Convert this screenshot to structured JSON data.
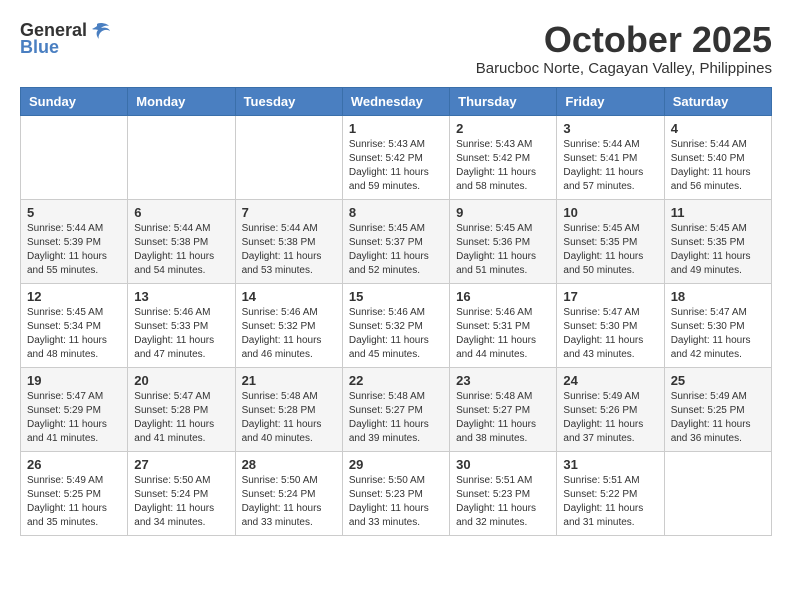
{
  "logo": {
    "general": "General",
    "blue": "Blue"
  },
  "title": "October 2025",
  "subtitle": "Barucboc Norte, Cagayan Valley, Philippines",
  "days_of_week": [
    "Sunday",
    "Monday",
    "Tuesday",
    "Wednesday",
    "Thursday",
    "Friday",
    "Saturday"
  ],
  "weeks": [
    [
      {
        "day": "",
        "info": ""
      },
      {
        "day": "",
        "info": ""
      },
      {
        "day": "",
        "info": ""
      },
      {
        "day": "1",
        "info": "Sunrise: 5:43 AM\nSunset: 5:42 PM\nDaylight: 11 hours and 59 minutes."
      },
      {
        "day": "2",
        "info": "Sunrise: 5:43 AM\nSunset: 5:42 PM\nDaylight: 11 hours and 58 minutes."
      },
      {
        "day": "3",
        "info": "Sunrise: 5:44 AM\nSunset: 5:41 PM\nDaylight: 11 hours and 57 minutes."
      },
      {
        "day": "4",
        "info": "Sunrise: 5:44 AM\nSunset: 5:40 PM\nDaylight: 11 hours and 56 minutes."
      }
    ],
    [
      {
        "day": "5",
        "info": "Sunrise: 5:44 AM\nSunset: 5:39 PM\nDaylight: 11 hours and 55 minutes."
      },
      {
        "day": "6",
        "info": "Sunrise: 5:44 AM\nSunset: 5:38 PM\nDaylight: 11 hours and 54 minutes."
      },
      {
        "day": "7",
        "info": "Sunrise: 5:44 AM\nSunset: 5:38 PM\nDaylight: 11 hours and 53 minutes."
      },
      {
        "day": "8",
        "info": "Sunrise: 5:45 AM\nSunset: 5:37 PM\nDaylight: 11 hours and 52 minutes."
      },
      {
        "day": "9",
        "info": "Sunrise: 5:45 AM\nSunset: 5:36 PM\nDaylight: 11 hours and 51 minutes."
      },
      {
        "day": "10",
        "info": "Sunrise: 5:45 AM\nSunset: 5:35 PM\nDaylight: 11 hours and 50 minutes."
      },
      {
        "day": "11",
        "info": "Sunrise: 5:45 AM\nSunset: 5:35 PM\nDaylight: 11 hours and 49 minutes."
      }
    ],
    [
      {
        "day": "12",
        "info": "Sunrise: 5:45 AM\nSunset: 5:34 PM\nDaylight: 11 hours and 48 minutes."
      },
      {
        "day": "13",
        "info": "Sunrise: 5:46 AM\nSunset: 5:33 PM\nDaylight: 11 hours and 47 minutes."
      },
      {
        "day": "14",
        "info": "Sunrise: 5:46 AM\nSunset: 5:32 PM\nDaylight: 11 hours and 46 minutes."
      },
      {
        "day": "15",
        "info": "Sunrise: 5:46 AM\nSunset: 5:32 PM\nDaylight: 11 hours and 45 minutes."
      },
      {
        "day": "16",
        "info": "Sunrise: 5:46 AM\nSunset: 5:31 PM\nDaylight: 11 hours and 44 minutes."
      },
      {
        "day": "17",
        "info": "Sunrise: 5:47 AM\nSunset: 5:30 PM\nDaylight: 11 hours and 43 minutes."
      },
      {
        "day": "18",
        "info": "Sunrise: 5:47 AM\nSunset: 5:30 PM\nDaylight: 11 hours and 42 minutes."
      }
    ],
    [
      {
        "day": "19",
        "info": "Sunrise: 5:47 AM\nSunset: 5:29 PM\nDaylight: 11 hours and 41 minutes."
      },
      {
        "day": "20",
        "info": "Sunrise: 5:47 AM\nSunset: 5:28 PM\nDaylight: 11 hours and 41 minutes."
      },
      {
        "day": "21",
        "info": "Sunrise: 5:48 AM\nSunset: 5:28 PM\nDaylight: 11 hours and 40 minutes."
      },
      {
        "day": "22",
        "info": "Sunrise: 5:48 AM\nSunset: 5:27 PM\nDaylight: 11 hours and 39 minutes."
      },
      {
        "day": "23",
        "info": "Sunrise: 5:48 AM\nSunset: 5:27 PM\nDaylight: 11 hours and 38 minutes."
      },
      {
        "day": "24",
        "info": "Sunrise: 5:49 AM\nSunset: 5:26 PM\nDaylight: 11 hours and 37 minutes."
      },
      {
        "day": "25",
        "info": "Sunrise: 5:49 AM\nSunset: 5:25 PM\nDaylight: 11 hours and 36 minutes."
      }
    ],
    [
      {
        "day": "26",
        "info": "Sunrise: 5:49 AM\nSunset: 5:25 PM\nDaylight: 11 hours and 35 minutes."
      },
      {
        "day": "27",
        "info": "Sunrise: 5:50 AM\nSunset: 5:24 PM\nDaylight: 11 hours and 34 minutes."
      },
      {
        "day": "28",
        "info": "Sunrise: 5:50 AM\nSunset: 5:24 PM\nDaylight: 11 hours and 33 minutes."
      },
      {
        "day": "29",
        "info": "Sunrise: 5:50 AM\nSunset: 5:23 PM\nDaylight: 11 hours and 33 minutes."
      },
      {
        "day": "30",
        "info": "Sunrise: 5:51 AM\nSunset: 5:23 PM\nDaylight: 11 hours and 32 minutes."
      },
      {
        "day": "31",
        "info": "Sunrise: 5:51 AM\nSunset: 5:22 PM\nDaylight: 11 hours and 31 minutes."
      },
      {
        "day": "",
        "info": ""
      }
    ]
  ]
}
